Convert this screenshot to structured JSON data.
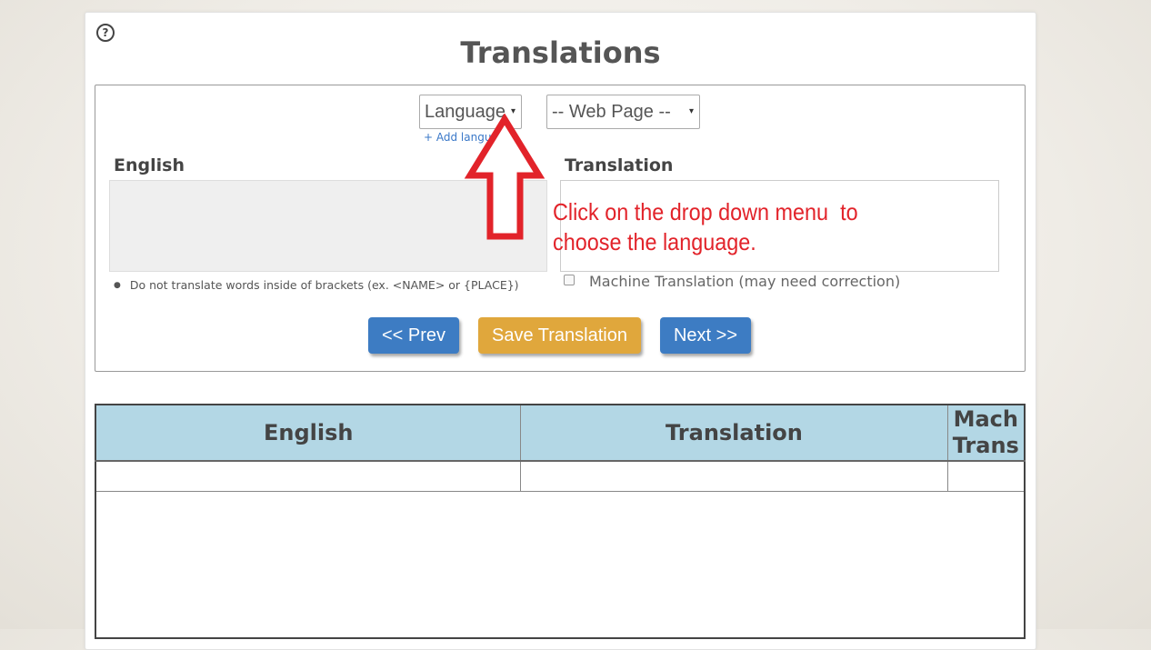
{
  "page": {
    "title": "Translations",
    "help_icon": "help-circle-icon"
  },
  "editor": {
    "language_select": {
      "value": "Language",
      "caret": "▾"
    },
    "webpage_select": {
      "value": "-- Web Page --",
      "caret": "▾"
    },
    "add_languages_link": "+ Add languages",
    "english_label": "English",
    "translation_label": "Translation",
    "note": "Do not translate words inside of brackets (ex. <NAME> or {PLACE})",
    "machine_translation_label": "Machine Translation (may need correction)",
    "buttons": {
      "prev": "<< Prev",
      "save": "Save Translation",
      "next": "Next >>"
    }
  },
  "annotation": {
    "line1": "Click on the drop down menu  to",
    "line2": "choose the language."
  },
  "table": {
    "headers": {
      "english": "English",
      "translation": "Translation",
      "mach_line1": "Mach",
      "mach_line2": "Trans"
    }
  },
  "colors": {
    "primary_button": "#3d7cc3",
    "save_button": "#e0a73c",
    "table_header": "#b3d7e5",
    "annotation": "#e2232a"
  }
}
